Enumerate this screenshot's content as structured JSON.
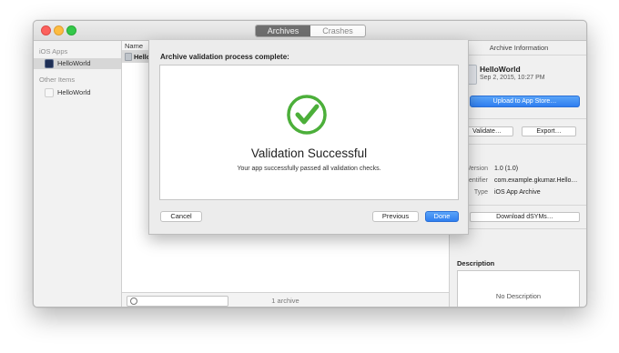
{
  "window": {
    "segments": [
      "Archives",
      "Crashes"
    ],
    "active_segment": "Archives"
  },
  "sidebar": {
    "sections": [
      {
        "header": "iOS Apps",
        "items": [
          {
            "label": "HelloWorld",
            "selected": true,
            "icon": "app-icon"
          }
        ]
      },
      {
        "header": "Other Items",
        "items": [
          {
            "label": "HelloWorld",
            "selected": false,
            "icon": "archive-icon"
          }
        ]
      }
    ]
  },
  "list": {
    "column_name": "Name",
    "rows": [
      {
        "name": "Hello"
      }
    ],
    "archive_count": "1 archive",
    "filter_icon": "filter-icon"
  },
  "inspector": {
    "title": "Archive Information",
    "app_name": "HelloWorld",
    "date": "Sep 2, 2015, 10:27 PM",
    "upload_label": "Upload to App Store…",
    "validate_label": "Validate…",
    "export_label": "Export…",
    "details_header": "ils",
    "details": [
      {
        "label": "Version",
        "value": "1.0 (1.0)"
      },
      {
        "label": "entifier",
        "value": "com.example.gkumar.Hello…"
      },
      {
        "label": "Type",
        "value": "iOS App Archive"
      }
    ],
    "download_label": "Download dSYMs…",
    "description_header": "Description",
    "description_placeholder": "No Description"
  },
  "sheet": {
    "title": "Archive validation process complete:",
    "status_title": "Validation Successful",
    "status_message": "Your app successfully passed all validation checks.",
    "status_icon": "checkmark-icon",
    "status_color": "#4caf3a",
    "cancel_label": "Cancel",
    "previous_label": "Previous",
    "done_label": "Done"
  }
}
